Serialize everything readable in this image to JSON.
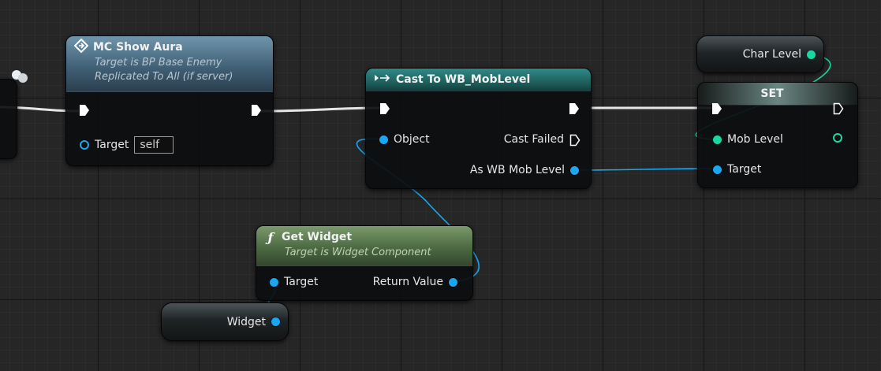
{
  "nodes": {
    "mc_show_aura": {
      "title": "MC Show Aura",
      "subtitle_1": "Target is BP Base Enemy",
      "subtitle_2": "Replicated To All (if server)",
      "target_label": "Target",
      "target_value": "self",
      "header_color": "#5a7d93"
    },
    "cast": {
      "title": "Cast To WB_MobLevel",
      "object_label": "Object",
      "cast_failed_label": "Cast Failed",
      "as_label": "As WB Mob Level",
      "header_color": "#1f6a68"
    },
    "set": {
      "title": "SET",
      "mob_level_label": "Mob Level",
      "target_label": "Target",
      "header_color": "#5f7672"
    },
    "get_widget": {
      "title": "Get Widget",
      "subtitle": "Target is Widget Component",
      "target_label": "Target",
      "return_label": "Return Value",
      "header_color": "#5d7a52"
    },
    "char_level": {
      "label": "Char Level"
    },
    "widget": {
      "label": "Widget"
    }
  },
  "icons": {
    "event": "diamond-event-icon",
    "cast": "cast-arrows-icon",
    "function": "function-f-icon"
  },
  "colors": {
    "exec": "#ffffff",
    "object_pin": "#1aa6f0",
    "variable_pin": "#18d9a0"
  }
}
